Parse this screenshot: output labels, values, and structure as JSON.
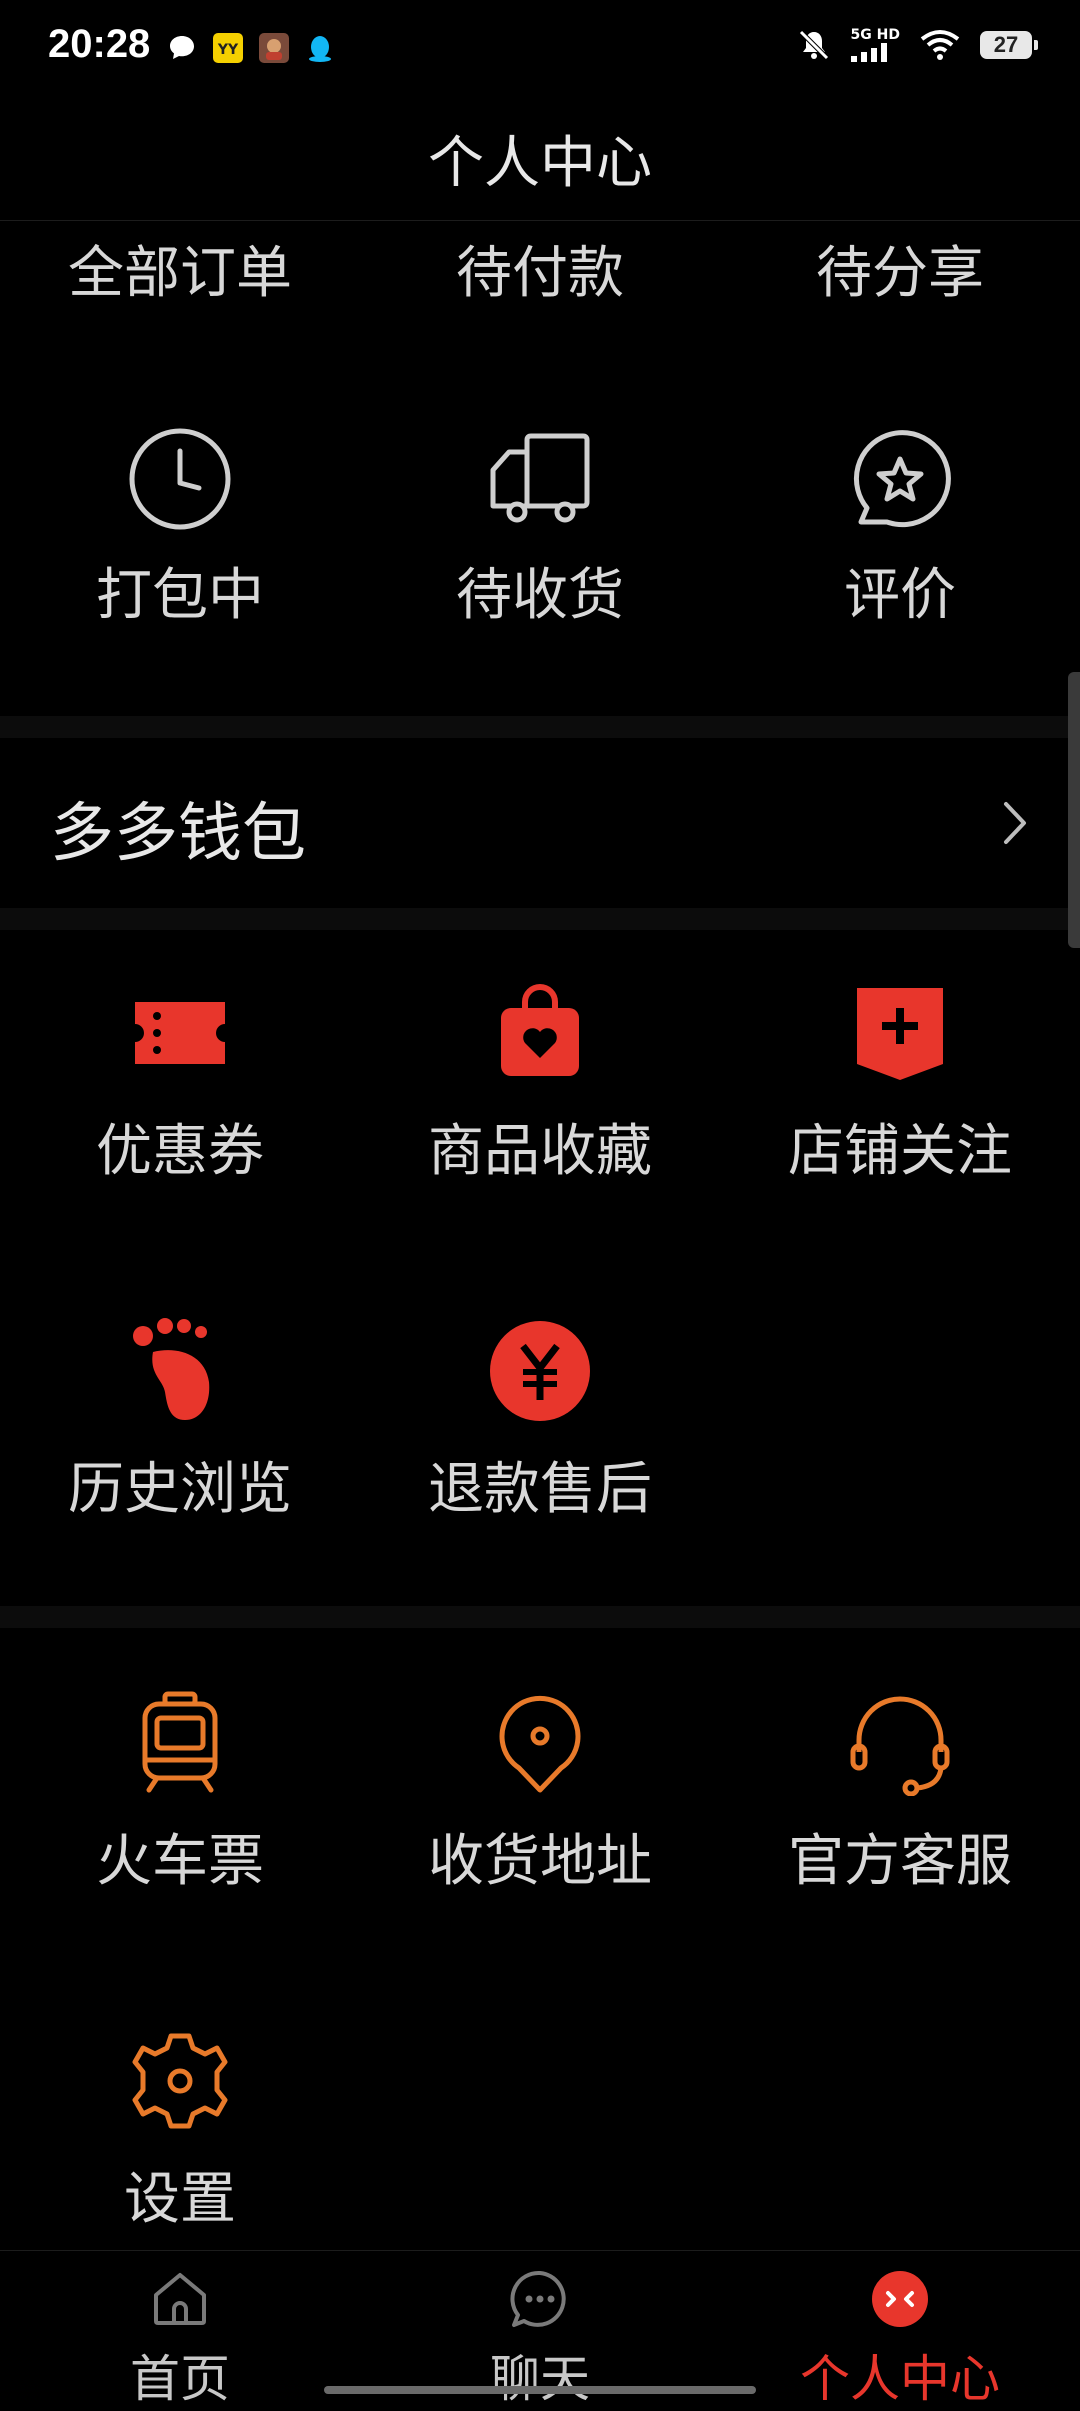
{
  "status_bar": {
    "time": "20:28",
    "network": "5G HD",
    "battery": "27"
  },
  "header": {
    "title": "个人中心"
  },
  "orders": {
    "row1": [
      "全部订单",
      "待付款",
      "待分享"
    ],
    "row2": [
      {
        "label": "打包中",
        "icon": "clock-icon"
      },
      {
        "label": "待收货",
        "icon": "truck-icon"
      },
      {
        "label": "评价",
        "icon": "star-bubble-icon"
      }
    ]
  },
  "wallet": {
    "label": "多多钱包"
  },
  "services": [
    {
      "label": "优惠券",
      "icon": "coupon-icon"
    },
    {
      "label": "商品收藏",
      "icon": "favorite-bag-icon"
    },
    {
      "label": "店铺关注",
      "icon": "store-follow-icon"
    },
    {
      "label": "历史浏览",
      "icon": "footprint-icon"
    },
    {
      "label": "退款售后",
      "icon": "yuan-icon"
    }
  ],
  "tools": [
    {
      "label": "火车票",
      "icon": "train-icon"
    },
    {
      "label": "收货地址",
      "icon": "location-pin-icon"
    },
    {
      "label": "官方客服",
      "icon": "headset-icon"
    },
    {
      "label": "设置",
      "icon": "settings-gear-icon"
    }
  ],
  "bottom_nav": [
    {
      "label": "首页",
      "icon": "home-icon"
    },
    {
      "label": "聊天",
      "icon": "chat-icon"
    },
    {
      "label": "个人中心",
      "icon": "profile-face-icon"
    }
  ],
  "colors": {
    "accent_red": "#e8362c",
    "accent_orange": "#e87a2a",
    "text": "#d8d8d8",
    "background": "#000000"
  }
}
